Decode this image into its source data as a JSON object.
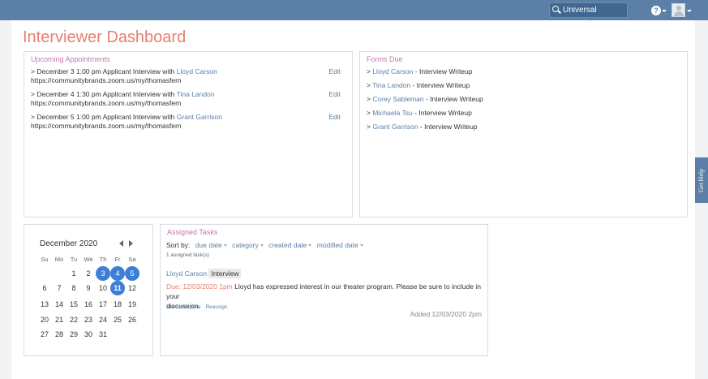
{
  "header": {
    "search_label": "Universal Search...",
    "help_label": "?"
  },
  "page": {
    "title": "Interviewer Dashboard"
  },
  "appointments": {
    "title": "Upcoming Appointments",
    "edit_label": "Edit",
    "items": [
      {
        "prefix": "> December 3 1:00 pm Applicant Interview with ",
        "name": "Lloyd Carson",
        "url": "https://communitybrands.zoom.us/my/thomasfern"
      },
      {
        "prefix": "> December 4 1:30 pm Applicant Interview with ",
        "name": "Tina Landon",
        "url": "https://communitybrands.zoom.us/my/thomasfern"
      },
      {
        "prefix": "> December 5 1:00 pm Applicant Interview with ",
        "name": "Grant Garrison",
        "url": "https://communitybrands.zoom.us/my/thomasfern"
      }
    ]
  },
  "forms": {
    "title": "Forms Due",
    "items": [
      {
        "prefix": "> ",
        "name": "Lloyd Carson",
        "suffix": " - Interview Writeup"
      },
      {
        "prefix": "> ",
        "name": "Tina Landon",
        "suffix": " - Interview Writeup"
      },
      {
        "prefix": "> ",
        "name": "Corey Sableman",
        "suffix": " - Interview Writeup"
      },
      {
        "prefix": "> ",
        "name": "Michaela Tsu",
        "suffix": " - Interview Writeup"
      },
      {
        "prefix": "> ",
        "name": "Grant Garrison",
        "suffix": " - Interview Writeup"
      }
    ]
  },
  "get_help": "Get Help",
  "calendar": {
    "month": "December 2020",
    "dow": [
      "Su",
      "Mo",
      "Tu",
      "We",
      "Th",
      "Fr",
      "Sa"
    ],
    "weeks": [
      [
        "",
        "",
        "1",
        "2",
        "3",
        "4",
        "5"
      ],
      [
        "6",
        "7",
        "8",
        "9",
        "10",
        "11",
        "12"
      ],
      [
        "13",
        "14",
        "15",
        "16",
        "17",
        "18",
        "19"
      ],
      [
        "20",
        "21",
        "22",
        "23",
        "24",
        "25",
        "26"
      ],
      [
        "27",
        "28",
        "29",
        "30",
        "31",
        "",
        ""
      ]
    ],
    "selected": [
      "3",
      "4",
      "5"
    ],
    "today": "11"
  },
  "tasks": {
    "title": "Assigned Tasks",
    "sort_by": "Sort by:",
    "sort_options": [
      "due date",
      "category",
      "created date",
      "modified date"
    ],
    "count": "1 assigned task(s)",
    "item": {
      "name": "Lloyd Carson",
      "tag": "Interview",
      "due": "Due: 12/03/2020 1pm",
      "text_1": " Lloyd has expressed interest in our theater program. Please be sure to include in your",
      "text_2": "discussion.",
      "mark_complete": "Mark complete",
      "reassign": "Reassign",
      "added": "Added 12/03/2020 2pm"
    }
  }
}
